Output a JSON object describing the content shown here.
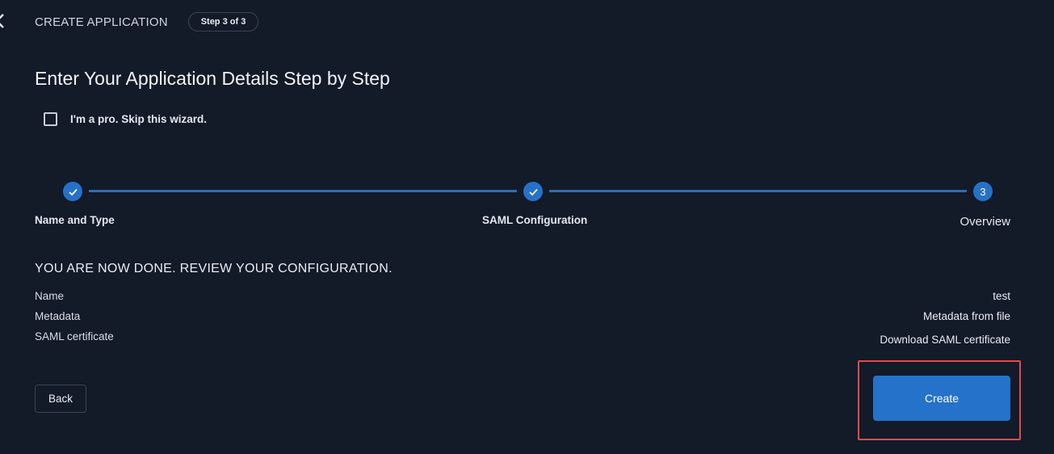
{
  "header": {
    "title": "CREATE APPLICATION",
    "step_badge": "Step 3 of 3"
  },
  "page_title": "Enter Your Application Details Step by Step",
  "skip_wizard": {
    "label": "I'm a pro. Skip this wizard.",
    "checked": false
  },
  "stepper": {
    "steps": [
      {
        "label": "Name and Type",
        "state": "complete",
        "icon": "check-icon"
      },
      {
        "label": "SAML Configuration",
        "state": "complete",
        "icon": "check-icon"
      },
      {
        "label": "Overview",
        "state": "current",
        "number": "3"
      }
    ]
  },
  "review": {
    "heading": "YOU ARE NOW DONE. REVIEW YOUR CONFIGURATION.",
    "rows": [
      {
        "key": "Name",
        "value": "test"
      },
      {
        "key": "Metadata",
        "value": "Metadata from file"
      },
      {
        "key": "SAML certificate",
        "value": "Download SAML certificate"
      }
    ]
  },
  "actions": {
    "back_label": "Back",
    "create_label": "Create"
  },
  "colors": {
    "background": "#131a28",
    "accent": "#2472c9",
    "highlight": "#e14b4b"
  }
}
